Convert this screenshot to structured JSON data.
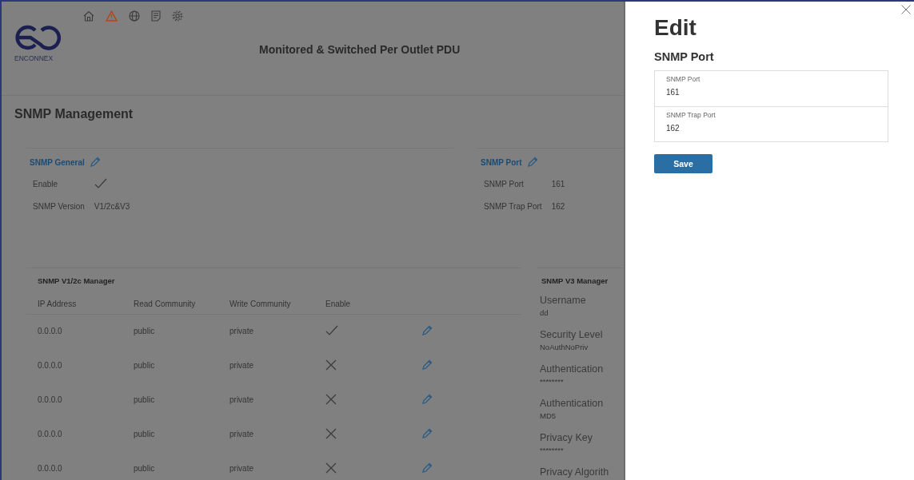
{
  "header": {
    "logo_text": "ENCONNEX",
    "nav_icons": [
      {
        "kind": "home"
      },
      {
        "kind": "warning"
      },
      {
        "kind": "globe"
      },
      {
        "kind": "log"
      },
      {
        "kind": "settings"
      }
    ],
    "title": "Monitored & Switched Per Outlet PDU"
  },
  "page_title": "SNMP Management",
  "snmp_general": {
    "title": "SNMP General",
    "enable": {
      "label": "Enable",
      "checked": true
    },
    "version": {
      "label": "SNMP Version",
      "value": "V1/2c&V3"
    }
  },
  "snmp_port": {
    "title": "SNMP Port",
    "rows": [
      {
        "label": "SNMP Port",
        "value": "161"
      },
      {
        "label": "SNMP Trap Port",
        "value": "162"
      }
    ]
  },
  "v12c_manager": {
    "title": "SNMP V1/2c Manager",
    "columns": [
      "IP Address",
      "Read Community",
      "Write Community",
      "Enable"
    ],
    "rows": [
      {
        "ip": "0.0.0.0",
        "read": "public",
        "write": "private",
        "enabled": true
      },
      {
        "ip": "0.0.0.0",
        "read": "public",
        "write": "private",
        "enabled": false
      },
      {
        "ip": "0.0.0.0",
        "read": "public",
        "write": "private",
        "enabled": false
      },
      {
        "ip": "0.0.0.0",
        "read": "public",
        "write": "private",
        "enabled": false
      },
      {
        "ip": "0.0.0.0",
        "read": "public",
        "write": "private",
        "enabled": false
      }
    ]
  },
  "v3_manager": {
    "title": "SNMP V3 Manager",
    "fields": [
      {
        "label": "Username",
        "value": "dd"
      },
      {
        "label": "Security Level",
        "value": "NoAuthNoPriv"
      },
      {
        "label": "Authentication",
        "value": "********"
      },
      {
        "label": "Authentication",
        "value": "MD5"
      },
      {
        "label": "Privacy Key",
        "value": "********"
      },
      {
        "label": "Privacy Algorith"
      }
    ]
  },
  "edit_panel": {
    "title": "Edit",
    "section": "SNMP Port",
    "fields": [
      {
        "label": "SNMP Port",
        "value": "161"
      },
      {
        "label": "SNMP Trap Port",
        "value": "162"
      }
    ],
    "save": "Save"
  }
}
